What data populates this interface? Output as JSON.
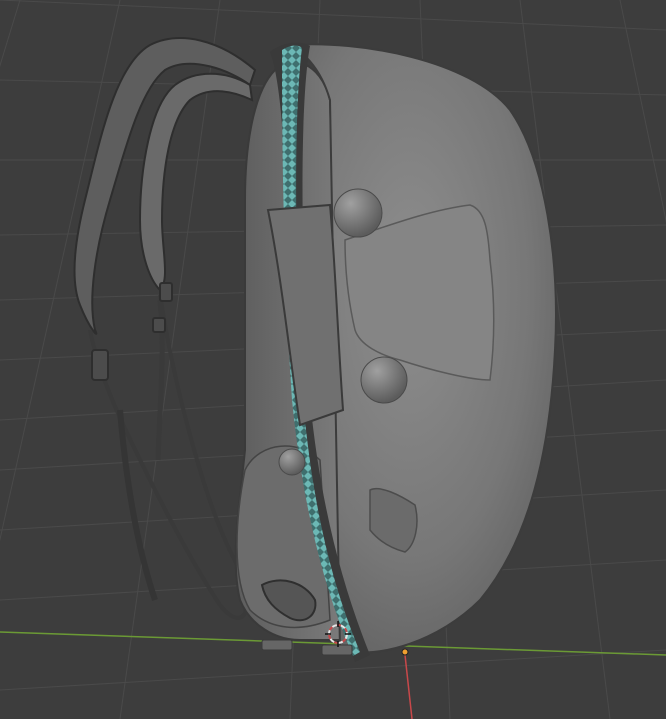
{
  "viewport": {
    "background_color": "#3d3d3d",
    "grid_color": "#4a4a4a",
    "x_axis_color": "#8cc33c",
    "y_axis_color": "#c8484a",
    "origin_color": "#f0a030"
  },
  "model": {
    "body_color": "#767676",
    "zipper_color": "#5fa7a5",
    "strap_color": "#5e5e5e"
  },
  "gizmos": {
    "cursor_icon": "3d-cursor-icon",
    "origin_icon": "object-origin-icon"
  }
}
